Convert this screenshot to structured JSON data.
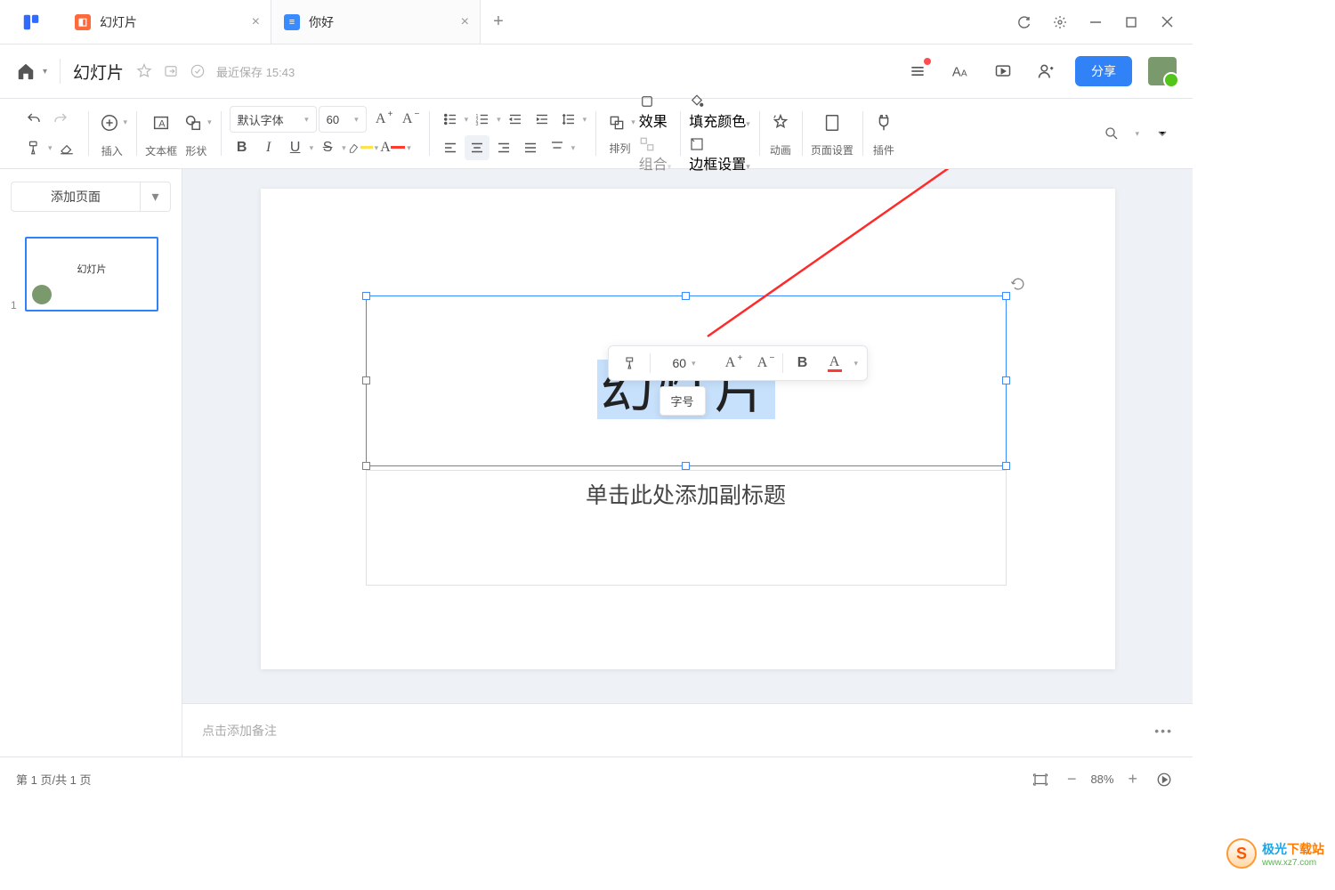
{
  "tabs": [
    {
      "title": "幻灯片",
      "icon": "ppt"
    },
    {
      "title": "你好",
      "icon": "doc"
    }
  ],
  "doc": {
    "title": "幻灯片",
    "save_prefix": "最近保存",
    "save_time": "15:43"
  },
  "header_right": {
    "share": "分享"
  },
  "toolbar": {
    "insert": "插入",
    "textbox": "文本框",
    "shape": "形状",
    "font_name": "默认字体",
    "font_size": "60",
    "bold": "B",
    "italic": "I",
    "underline": "U",
    "align": "排列",
    "effect": "效果",
    "group": "组合",
    "fill": "填充颜色",
    "border": "边框设置",
    "anim": "动画",
    "page": "页面设置",
    "plugin": "插件"
  },
  "sidebar": {
    "add_page": "添加页面",
    "thumb_index": "1",
    "thumb_title": "幻灯片"
  },
  "slide": {
    "title_text": "幻灯片",
    "subtitle_placeholder": "单击此处添加副标题"
  },
  "floatbar": {
    "size": "60",
    "tooltip": "字号"
  },
  "notes": {
    "placeholder": "点击添加备注"
  },
  "status": {
    "page": "第 1 页/共 1 页",
    "zoom": "88%"
  },
  "watermark": {
    "a": "极光",
    "b": "下载站",
    "c": "www.xz7.com"
  }
}
